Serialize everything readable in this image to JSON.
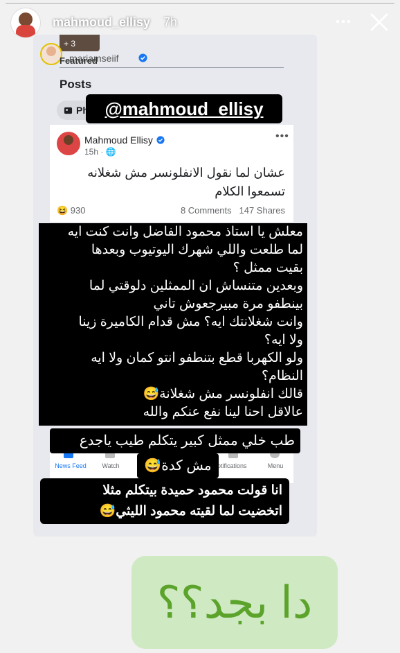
{
  "story": {
    "username": "mahmoud_ellisy",
    "time": "7h",
    "more_label": "•••",
    "close_label": "✕"
  },
  "screenshot": {
    "thumb_count": "+ 3",
    "mini_name": "mariamseiif",
    "featured_label": "Featured",
    "posts_label": "Posts",
    "filter_pill": "Ph",
    "post": {
      "author": "Mahmoud Ellisy",
      "meta": "15h · 🌐",
      "text": "عشان لما نقول الانفلونسر مش شغلانه تسمعوا الكلام",
      "reactions": "😆 930",
      "comments": "8 Comments",
      "shares": "147 Shares"
    },
    "tabs": [
      {
        "label": "News Feed"
      },
      {
        "label": "Watch"
      },
      {
        "label": "Notifications"
      },
      {
        "label": "Menu"
      }
    ]
  },
  "overlays": {
    "mention": "@mahmoud_ellisy",
    "lines": [
      "معلش يا استاذ محمود الفاضل وانت كنت ايه",
      "لما طلعت واللي شهرك اليوتيوب وبعدها",
      "بقيت ممثل ؟",
      "وبعدين متنساش ان الممثلين دلوقتي لما",
      "بينطفو مرة مبيرجعوش تاني",
      "وانت شغلانتك ايه؟ مش قدام الكاميرة زينا",
      "ولا ايه؟",
      "ولو الكهربا قطع بتنطفو انتو كمان ولا ايه",
      "النظام؟",
      "قالك انفلونسر مش شغلانة😅",
      "عالاقل احنا لينا نفع عنكم والله"
    ],
    "box2": "طب خلي ممثل كبير يتكلم طيب ياجدع",
    "box3": "مش كدة😅",
    "box4_line1": "انا قولت محمود حميدة بيتكلم مثلا",
    "box4_line2": "اتخضيت لما لقيته محمود الليثي😅",
    "question": "دا بجد؟؟"
  },
  "colors": {
    "accent_blue": "#1877f2",
    "answer_green": "#5ba32a",
    "answer_bg": "#cfeac3"
  }
}
